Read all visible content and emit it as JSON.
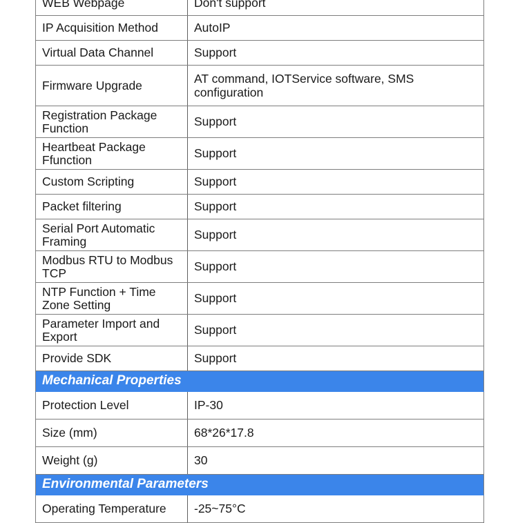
{
  "table": {
    "rows": [
      {
        "type": "data",
        "label": "WEB Webpage",
        "value": "Don't support"
      },
      {
        "type": "data",
        "label": "IP Acquisition Method",
        "value": "AutoIP"
      },
      {
        "type": "data",
        "label": "Virtual Data Channel",
        "value": "Support"
      },
      {
        "type": "data",
        "label": "Firmware Upgrade",
        "value": "AT command, IOTService software, SMS configuration"
      },
      {
        "type": "data",
        "label": "Registration Package Function",
        "value": "Support"
      },
      {
        "type": "data",
        "label": "Heartbeat Package Ffunction",
        "value": "Support"
      },
      {
        "type": "data",
        "label": "Custom Scripting",
        "value": "Support"
      },
      {
        "type": "data",
        "label": "Packet filtering",
        "value": "Support"
      },
      {
        "type": "data",
        "label": "Serial Port Automatic Framing",
        "value": "Support"
      },
      {
        "type": "data",
        "label": "Modbus RTU to Modbus TCP",
        "value": "Support"
      },
      {
        "type": "data",
        "label": "NTP Function + Time Zone Setting",
        "value": "Support"
      },
      {
        "type": "data",
        "label": "Parameter Import and Export",
        "value": "Support"
      },
      {
        "type": "data",
        "label": "Provide SDK",
        "value": "Support"
      },
      {
        "type": "section",
        "label": "Mechanical Properties"
      },
      {
        "type": "data",
        "label": "Protection Level",
        "value": "IP-30"
      },
      {
        "type": "data",
        "label": "Size (mm)",
        "value": "68*26*17.8"
      },
      {
        "type": "data",
        "label": "Weight (g)",
        "value": "30"
      },
      {
        "type": "section",
        "label": "Environmental Parameters"
      },
      {
        "type": "data",
        "label": "Operating Temperature",
        "value": "-25~75°C"
      }
    ]
  },
  "colors": {
    "section_header_background": "#3b85ea",
    "section_header_text": "#ffffff",
    "table_border": "#7d7d7d",
    "body_text": "#1a1a1a",
    "page_background": "#ffffff"
  }
}
